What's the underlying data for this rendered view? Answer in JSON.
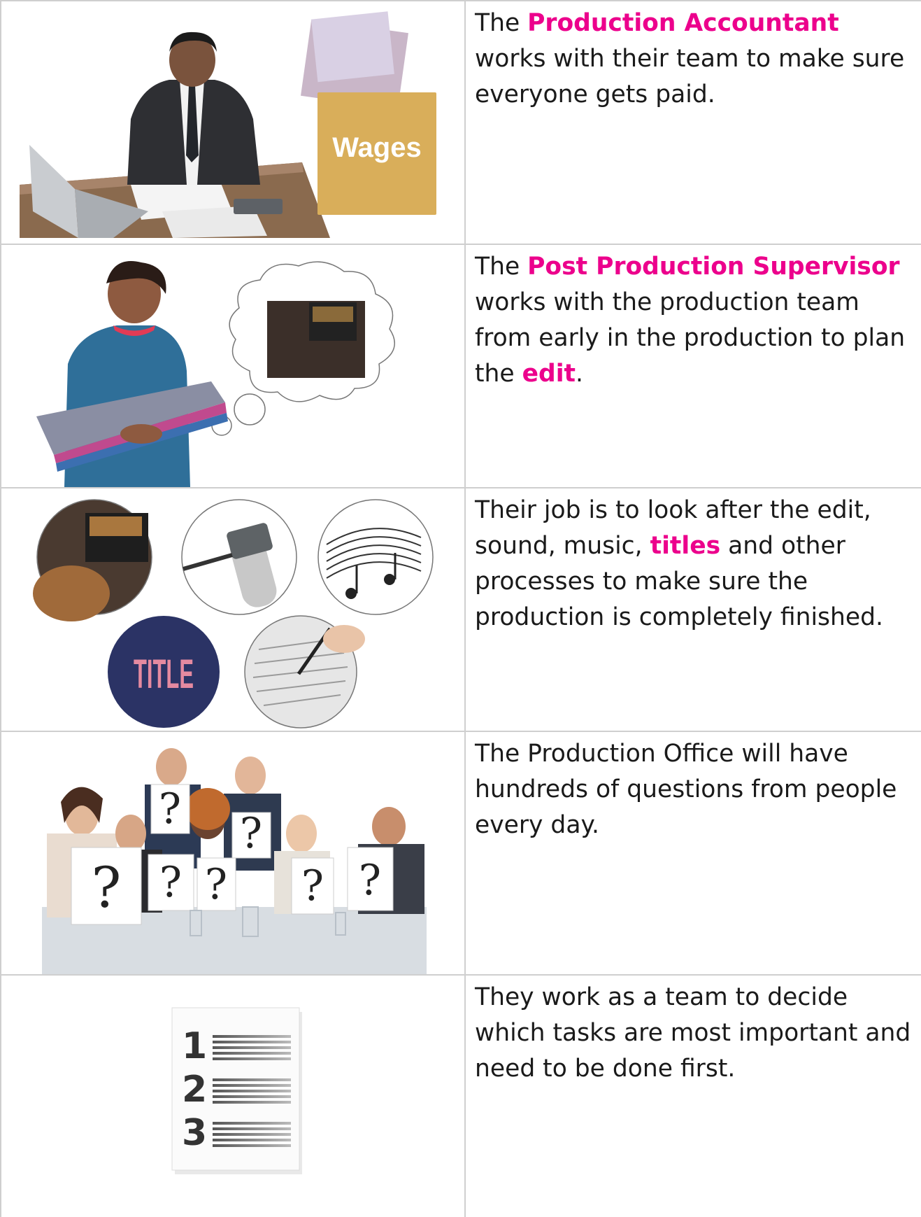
{
  "rows": [
    {
      "text": {
        "pre": "The ",
        "em": "Production Accountant",
        "post": " works with their team to make sure everyone gets paid."
      },
      "image": {
        "name": "accountant-photo",
        "envelope_label": "Wages"
      }
    },
    {
      "text": {
        "pre": "The ",
        "em": "Post Production Supervisor",
        "mid": " works with the production team from early in the production to plan the ",
        "em2": "edit",
        "post": "."
      },
      "image": {
        "name": "supervisor-photo"
      }
    },
    {
      "text": {
        "pre": "Their job is to look after the edit, sound, music, ",
        "em": "titles",
        "post": " and other processes to make sure the production is completely finished."
      },
      "image": {
        "name": "post-production-icons",
        "title_label": "TITLE"
      }
    },
    {
      "text": {
        "pre": "The Production Office will have hundreds of questions from people every day."
      },
      "image": {
        "name": "people-questions-photo",
        "mark": "?"
      }
    },
    {
      "text": {
        "pre": "They work as a team to decide which tasks are most important and need to be done first."
      },
      "image": {
        "name": "numbered-list-icon",
        "numbers": [
          "1",
          "2",
          "3"
        ]
      }
    }
  ],
  "colors": {
    "highlight": "#ec008c",
    "border": "#cfcfcf",
    "envelope": "#d9ae5a",
    "title_circle": "#2b3365",
    "title_text": "#e58aa0"
  }
}
